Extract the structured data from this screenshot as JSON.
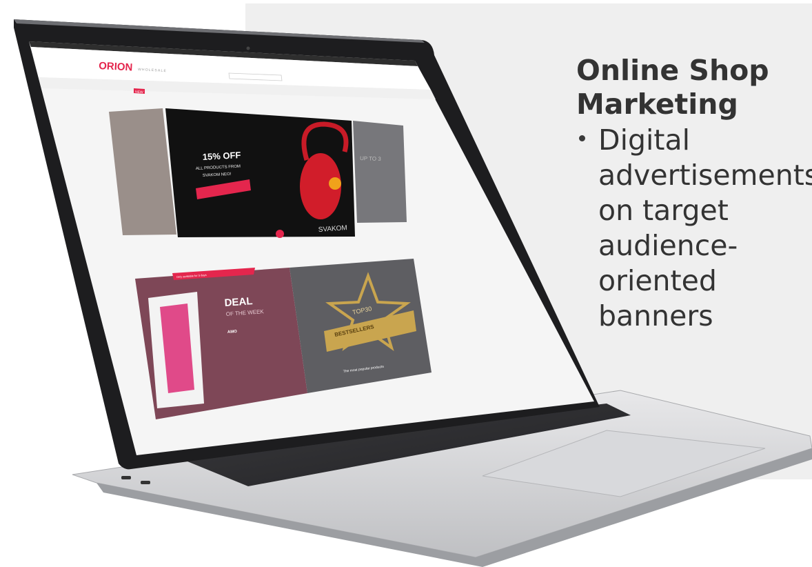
{
  "text": {
    "headline": "Online Shop\nMarketing",
    "bullet": "Digital\nadvertisements\non target\naudience-\noriented\nbanners"
  },
  "site": {
    "logo": "ORION",
    "logo_sub": "WHOLESALE",
    "nav_new": "NEW",
    "hero": {
      "discount": "15% OFF",
      "line1": "ALL PRODUCTS FROM",
      "line2": "SVAKOM NEO!",
      "brand": "SVAKOM",
      "side_right": "UP TO 3"
    },
    "deal_ribbon": "Only available for 5 days",
    "deal_title": "DEAL",
    "deal_sub": "OF THE WEEK",
    "deal_product": "AMO",
    "top_badge": "TOP30",
    "top_ribbon": "BESTSELLERS",
    "top_caption": "The most popular products"
  },
  "colors": {
    "accent": "#e4264d",
    "text": "#333333",
    "panel": "#efefef",
    "deal_bg": "#7e4757",
    "top_bg": "#5e5e62"
  }
}
